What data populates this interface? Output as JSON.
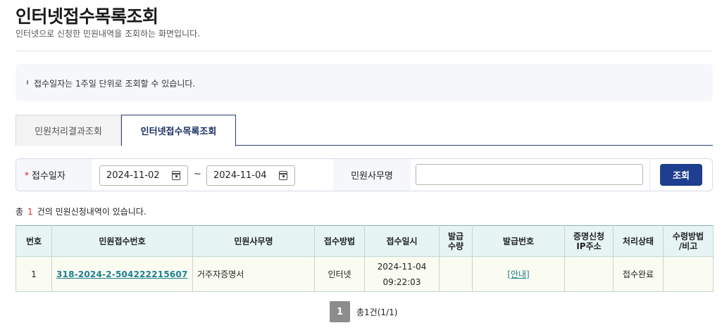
{
  "header": {
    "title": "인터넷접수목록조회",
    "subtitle": "인터넷으로 신청한 민원내역을 조회하는 화면입니다."
  },
  "notice": {
    "text": "접수일자는 1주일 단위로 조회할 수 있습니다."
  },
  "tabs": [
    {
      "label": "민원처리결과조회",
      "active": false
    },
    {
      "label": "인터넷접수목록조회",
      "active": true
    }
  ],
  "search": {
    "required_mark": "*",
    "date_label": "접수일자",
    "date_from": "2024-11-02",
    "date_to": "2024-11-04",
    "date_separator": "~",
    "name_label": "민원사무명",
    "name_value": "",
    "button_label": "조회"
  },
  "result": {
    "prefix": "총",
    "count": "1",
    "suffix": "건의 민원신청내역이 있습니다."
  },
  "table": {
    "headers": [
      "번호",
      "민원접수번호",
      "민원사무명",
      "접수방법",
      "접수일시",
      "발급수량",
      "발급번호",
      "증명신청IP주소",
      "처리상태",
      "수령방법/비고"
    ],
    "rows": [
      {
        "no": "1",
        "receipt_no": "318-2024-2-504222215607",
        "name": "거주자증명서",
        "method": "인터넷",
        "date": "2024-11-04",
        "time": "09:22:03",
        "qty": "",
        "issue_no": "[안내]",
        "ip": "",
        "status": "접수완료",
        "remark": ""
      }
    ]
  },
  "pagination": {
    "current": "1",
    "summary": "총1건(1/1)"
  }
}
